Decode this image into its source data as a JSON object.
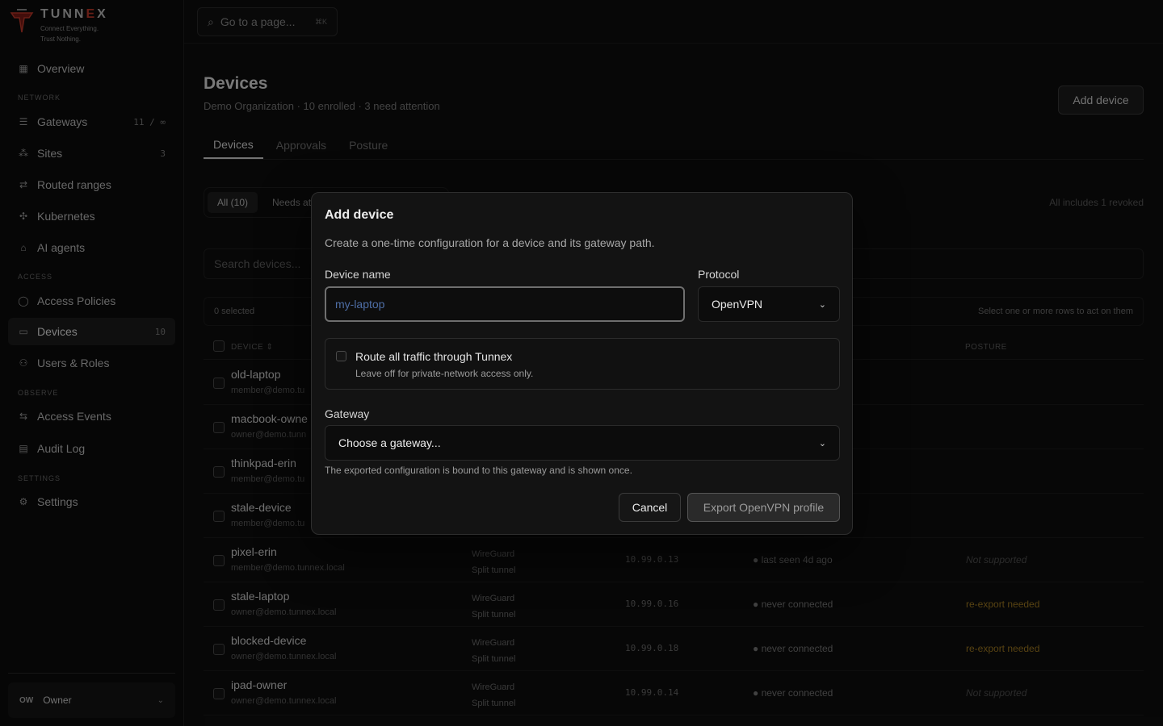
{
  "brand": {
    "name_prefix": "TUNN",
    "name_x": "E",
    "name_suffix": "X",
    "tag_line1": "Connect Everything.",
    "tag_line2": "Trust Nothing.",
    "accent": "#c0392b"
  },
  "sidebar": {
    "overview": "Overview",
    "section_network": "NETWORK",
    "gateways": {
      "label": "Gateways",
      "count": "11 / ∞"
    },
    "sites": {
      "label": "Sites",
      "count": "3"
    },
    "routed_ranges": "Routed ranges",
    "kubernetes": "Kubernetes",
    "ai_agents": "AI agents",
    "section_access": "ACCESS",
    "access_policies": "Access Policies",
    "devices": {
      "label": "Devices",
      "count": "10"
    },
    "users_roles": "Users & Roles",
    "section_observe": "OBSERVE",
    "access_events": "Access Events",
    "audit_log": "Audit Log",
    "section_settings": "SETTINGS",
    "settings": "Settings",
    "owner": {
      "initials": "OW",
      "label": "Owner"
    }
  },
  "topbar": {
    "search_placeholder": "Go to a page...",
    "shortcut": "⌘K"
  },
  "page": {
    "title": "Devices",
    "subtitle": "Demo Organization · 10 enrolled · 3 need attention",
    "add_button": "Add device",
    "tabs": [
      "Devices",
      "Approvals",
      "Posture"
    ],
    "filter_all": "All (10)",
    "filter_needs": "Needs at",
    "all_note": "All includes 1 revoked",
    "search_placeholder": "Search devices...",
    "selected": "0 selected",
    "select_hint": "Select one or more rows to act on them",
    "col_device": "DEVICE ⇕",
    "col_posture": "POSTURE"
  },
  "rows": [
    {
      "name": "old-laptop",
      "email": "member@demo.tu"
    },
    {
      "name": "macbook-owne",
      "email": "owner@demo.tunn"
    },
    {
      "name": "thinkpad-erin",
      "email": "member@demo.tu"
    },
    {
      "name": "stale-device",
      "email": "member@demo.tu"
    },
    {
      "name": "pixel-erin",
      "email": "member@demo.tunnex.local",
      "proto": "WireGuard",
      "mode": "Split tunnel",
      "ip": "10.99.0.13",
      "seen": "● last seen 4d ago",
      "posture": "Not supported"
    },
    {
      "name": "stale-laptop",
      "email": "owner@demo.tunnex.local",
      "proto": "WireGuard",
      "mode": "Split tunnel",
      "ip": "10.99.0.16",
      "seen": "● never connected",
      "posture": "re-export needed"
    },
    {
      "name": "blocked-device",
      "email": "owner@demo.tunnex.local",
      "proto": "WireGuard",
      "mode": "Split tunnel",
      "ip": "10.99.0.18",
      "seen": "● never connected",
      "posture": "re-export needed"
    },
    {
      "name": "ipad-owner",
      "email": "owner@demo.tunnex.local",
      "proto": "WireGuard",
      "mode": "Split tunnel",
      "ip": "10.99.0.14",
      "seen": "● never connected",
      "posture": "Not supported"
    }
  ],
  "modal": {
    "title": "Add device",
    "description": "Create a one-time configuration for a device and its gateway path.",
    "device_name_label": "Device name",
    "device_name_placeholder": "my-laptop",
    "device_name_value": "",
    "protocol_label": "Protocol",
    "protocol_value": "OpenVPN",
    "route_title": "Route all traffic through Tunnex",
    "route_sub": "Leave off for private-network access only.",
    "route_checked": false,
    "gateway_label": "Gateway",
    "gateway_value": "Choose a gateway...",
    "gateway_note": "The exported configuration is bound to this gateway and is shown once.",
    "cancel": "Cancel",
    "export": "Export OpenVPN profile"
  }
}
